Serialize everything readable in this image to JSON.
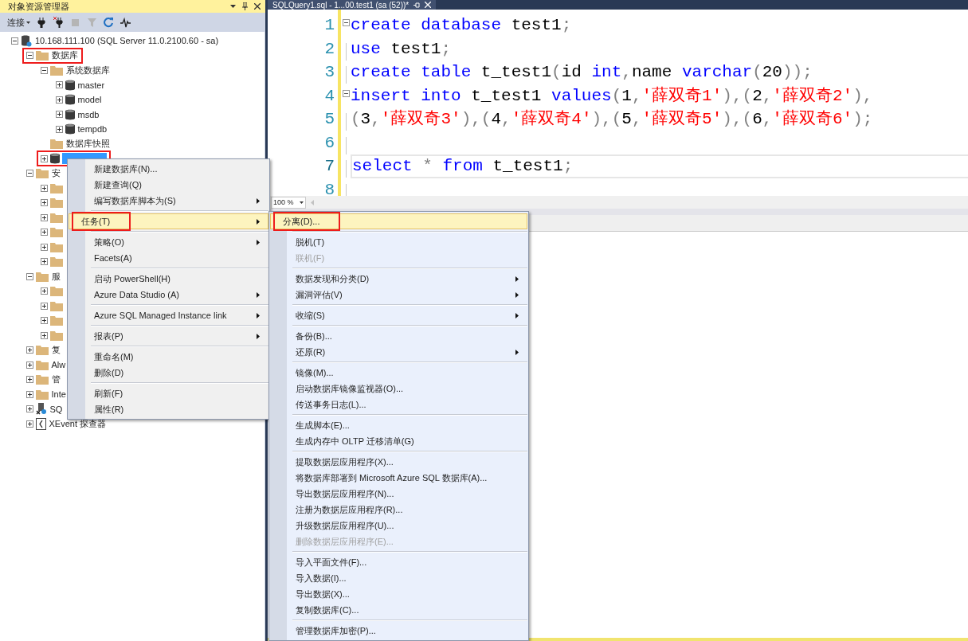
{
  "explorer": {
    "title": "对象资源管理器",
    "connect_label": "连接",
    "toolbar": [
      {
        "kind": "connect",
        "disabled": false
      },
      {
        "kind": "disconnect",
        "disabled": false
      },
      {
        "kind": "stop",
        "disabled": true
      },
      {
        "kind": "filter",
        "disabled": true
      },
      {
        "kind": "refresh",
        "disabled": false
      },
      {
        "kind": "activity",
        "disabled": false
      }
    ],
    "tree": [
      {
        "kind": "server",
        "label": "10.168.111.100 (SQL Server 11.0.2100.60 - sa)",
        "expanded": true,
        "selected": false,
        "annotated": false,
        "children": [
          {
            "kind": "folder",
            "label": "数据库",
            "expanded": true,
            "selected": false,
            "annotated": true,
            "children": [
              {
                "kind": "folder",
                "label": "系统数据库",
                "expanded": true,
                "selected": false,
                "annotated": false,
                "children": [
                  {
                    "kind": "database",
                    "label": "master",
                    "expanded": false,
                    "selected": false,
                    "annotated": false
                  },
                  {
                    "kind": "database",
                    "label": "model",
                    "expanded": false,
                    "selected": false,
                    "annotated": false
                  },
                  {
                    "kind": "database",
                    "label": "msdb",
                    "expanded": false,
                    "selected": false,
                    "annotated": false
                  },
                  {
                    "kind": "database",
                    "label": "tempdb",
                    "expanded": false,
                    "selected": false,
                    "annotated": false
                  }
                ]
              },
              {
                "kind": "folder",
                "label": "数据库快照",
                "selected": false,
                "annotated": false
              },
              {
                "kind": "database",
                "expanded": false,
                "selected": true,
                "annotated": true
              }
            ]
          },
          {
            "kind": "folder",
            "label": "安",
            "expanded": true,
            "selected": false,
            "annotated": false,
            "children": [
              {
                "kind": "folder",
                "expanded": false,
                "selected": false,
                "annotated": false
              },
              {
                "kind": "folder",
                "expanded": false,
                "selected": false,
                "annotated": false
              },
              {
                "kind": "folder",
                "expanded": false,
                "selected": false,
                "annotated": false
              },
              {
                "kind": "folder",
                "expanded": false,
                "selected": false,
                "annotated": false
              },
              {
                "kind": "folder",
                "expanded": false,
                "selected": false,
                "annotated": false
              },
              {
                "kind": "folder",
                "expanded": false,
                "selected": false,
                "annotated": false
              }
            ]
          },
          {
            "kind": "folder",
            "label": "服",
            "expanded": true,
            "selected": false,
            "annotated": false,
            "children": [
              {
                "kind": "folder",
                "expanded": false,
                "selected": false,
                "annotated": false
              },
              {
                "kind": "folder",
                "expanded": false,
                "selected": false,
                "annotated": false
              },
              {
                "kind": "folder",
                "expanded": false,
                "selected": false,
                "annotated": false
              },
              {
                "kind": "folder",
                "expanded": false,
                "selected": false,
                "annotated": false
              }
            ]
          },
          {
            "kind": "folder",
            "label": "复",
            "expanded": false,
            "selected": false,
            "annotated": false
          },
          {
            "kind": "folder",
            "label": "Alw",
            "expanded": false,
            "selected": false,
            "annotated": false
          },
          {
            "kind": "folder",
            "label": "管",
            "expanded": false,
            "selected": false,
            "annotated": false
          },
          {
            "kind": "folder",
            "label": "Inte",
            "expanded": false,
            "selected": false,
            "annotated": false
          },
          {
            "kind": "agent",
            "label": "SQ",
            "expanded": false,
            "selected": false,
            "annotated": false
          },
          {
            "kind": "xevent",
            "label": "XEvent 探查器",
            "expanded": false,
            "selected": false,
            "annotated": false
          }
        ]
      }
    ]
  },
  "editor": {
    "tab_title": "SQLQuery1.sql - 1...00.test1 (sa (52))*",
    "zoom": "100 %",
    "lines": [
      {
        "number": "1",
        "foldable": true,
        "current": false,
        "tokens": [
          {
            "kind": "keyword",
            "text": "create "
          },
          {
            "kind": "keyword",
            "text": "database"
          },
          {
            "kind": "text",
            "text": " test1"
          },
          {
            "kind": "punct",
            "text": ";"
          }
        ]
      },
      {
        "number": "2",
        "foldable": false,
        "current": false,
        "tokens": [
          {
            "kind": "keyword",
            "text": "use"
          },
          {
            "kind": "text",
            "text": " test1"
          },
          {
            "kind": "punct",
            "text": ";"
          }
        ]
      },
      {
        "number": "3",
        "foldable": false,
        "current": false,
        "tokens": [
          {
            "kind": "keyword",
            "text": "create "
          },
          {
            "kind": "keyword",
            "text": "table"
          },
          {
            "kind": "text",
            "text": " t_test1"
          },
          {
            "kind": "punct",
            "text": "("
          },
          {
            "kind": "text",
            "text": "id "
          },
          {
            "kind": "keyword",
            "text": "int"
          },
          {
            "kind": "punct",
            "text": ","
          },
          {
            "kind": "text",
            "text": "name "
          },
          {
            "kind": "keyword",
            "text": "varchar"
          },
          {
            "kind": "punct",
            "text": "("
          },
          {
            "kind": "text",
            "text": "20"
          },
          {
            "kind": "punct",
            "text": "));"
          }
        ]
      },
      {
        "number": "4",
        "foldable": true,
        "current": false,
        "tokens": [
          {
            "kind": "keyword",
            "text": "insert "
          },
          {
            "kind": "keyword",
            "text": "into"
          },
          {
            "kind": "text",
            "text": " t_test1 "
          },
          {
            "kind": "keyword",
            "text": "values"
          },
          {
            "kind": "punct",
            "text": "("
          },
          {
            "kind": "text",
            "text": "1"
          },
          {
            "kind": "punct",
            "text": ","
          },
          {
            "kind": "string",
            "text": "'薛双奇1'"
          },
          {
            "kind": "punct",
            "text": "),("
          },
          {
            "kind": "text",
            "text": "2"
          },
          {
            "kind": "punct",
            "text": ","
          },
          {
            "kind": "string",
            "text": "'薛双奇2'"
          },
          {
            "kind": "punct",
            "text": "),"
          }
        ]
      },
      {
        "number": "5",
        "foldable": false,
        "current": false,
        "tokens": [
          {
            "kind": "punct",
            "text": "("
          },
          {
            "kind": "text",
            "text": "3"
          },
          {
            "kind": "punct",
            "text": ","
          },
          {
            "kind": "string",
            "text": "'薛双奇3'"
          },
          {
            "kind": "punct",
            "text": "),("
          },
          {
            "kind": "text",
            "text": "4"
          },
          {
            "kind": "punct",
            "text": ","
          },
          {
            "kind": "string",
            "text": "'薛双奇4'"
          },
          {
            "kind": "punct",
            "text": "),("
          },
          {
            "kind": "text",
            "text": "5"
          },
          {
            "kind": "punct",
            "text": ","
          },
          {
            "kind": "string",
            "text": "'薛双奇5'"
          },
          {
            "kind": "punct",
            "text": "),("
          },
          {
            "kind": "text",
            "text": "6"
          },
          {
            "kind": "punct",
            "text": ","
          },
          {
            "kind": "string",
            "text": "'薛双奇6'"
          },
          {
            "kind": "punct",
            "text": ");"
          }
        ]
      },
      {
        "number": "6",
        "foldable": false,
        "current": false
      },
      {
        "number": "7",
        "foldable": false,
        "current": true,
        "tokens": [
          {
            "kind": "keyword",
            "text": "select "
          },
          {
            "kind": "punct",
            "text": "* "
          },
          {
            "kind": "keyword",
            "text": "from"
          },
          {
            "kind": "text",
            "text": " t_test1"
          },
          {
            "kind": "punct",
            "text": ";"
          }
        ]
      },
      {
        "number": "8",
        "foldable": false,
        "current": false
      }
    ]
  },
  "context_menu": {
    "items": [
      {
        "kind": "item",
        "label": "新建数据库(N)...",
        "submenu": false,
        "disabled": false,
        "selected": false,
        "annotated": false
      },
      {
        "kind": "item",
        "label": "新建查询(Q)",
        "submenu": false,
        "disabled": false,
        "selected": false,
        "annotated": false
      },
      {
        "kind": "item",
        "label": "编写数据库脚本为(S)",
        "submenu": true,
        "disabled": false,
        "selected": false,
        "annotated": false
      },
      {
        "kind": "separator"
      },
      {
        "kind": "item",
        "label": "任务(T)",
        "submenu": true,
        "disabled": false,
        "selected": true,
        "annotated": true
      },
      {
        "kind": "separator"
      },
      {
        "kind": "item",
        "label": "策略(O)",
        "submenu": true,
        "disabled": false,
        "selected": false,
        "annotated": false
      },
      {
        "kind": "item",
        "label": "Facets(A)",
        "submenu": false,
        "disabled": false,
        "selected": false,
        "annotated": false
      },
      {
        "kind": "separator"
      },
      {
        "kind": "item",
        "label": "启动 PowerShell(H)",
        "submenu": false,
        "disabled": false,
        "selected": false,
        "annotated": false
      },
      {
        "kind": "item",
        "label": "Azure Data Studio (A)",
        "submenu": true,
        "disabled": false,
        "selected": false,
        "annotated": false
      },
      {
        "kind": "separator"
      },
      {
        "kind": "item",
        "label": "Azure SQL Managed Instance link",
        "submenu": true,
        "disabled": false,
        "selected": false,
        "annotated": false
      },
      {
        "kind": "separator"
      },
      {
        "kind": "item",
        "label": "报表(P)",
        "submenu": true,
        "disabled": false,
        "selected": false,
        "annotated": false
      },
      {
        "kind": "separator"
      },
      {
        "kind": "item",
        "label": "重命名(M)",
        "submenu": false,
        "disabled": false,
        "selected": false,
        "annotated": false
      },
      {
        "kind": "item",
        "label": "删除(D)",
        "submenu": false,
        "disabled": false,
        "selected": false,
        "annotated": false
      },
      {
        "kind": "separator"
      },
      {
        "kind": "item",
        "label": "刷新(F)",
        "submenu": false,
        "disabled": false,
        "selected": false,
        "annotated": false
      },
      {
        "kind": "item",
        "label": "属性(R)",
        "submenu": false,
        "disabled": false,
        "selected": false,
        "annotated": false
      }
    ]
  },
  "tasks_submenu": {
    "items": [
      {
        "kind": "item",
        "label": "分离(D)...",
        "submenu": false,
        "disabled": false,
        "selected": true,
        "annotated": true
      },
      {
        "kind": "separator"
      },
      {
        "kind": "item",
        "label": "脱机(T)",
        "submenu": false,
        "disabled": false,
        "selected": false,
        "annotated": false
      },
      {
        "kind": "item",
        "label": "联机(F)",
        "submenu": false,
        "disabled": true,
        "selected": false,
        "annotated": false
      },
      {
        "kind": "separator"
      },
      {
        "kind": "item",
        "label": "数据发现和分类(D)",
        "submenu": true,
        "disabled": false,
        "selected": false,
        "annotated": false
      },
      {
        "kind": "item",
        "label": "漏洞评估(V)",
        "submenu": true,
        "disabled": false,
        "selected": false,
        "annotated": false
      },
      {
        "kind": "separator"
      },
      {
        "kind": "item",
        "label": "收缩(S)",
        "submenu": true,
        "disabled": false,
        "selected": false,
        "annotated": false
      },
      {
        "kind": "separator"
      },
      {
        "kind": "item",
        "label": "备份(B)...",
        "submenu": false,
        "disabled": false,
        "selected": false,
        "annotated": false
      },
      {
        "kind": "item",
        "label": "还原(R)",
        "submenu": true,
        "disabled": false,
        "selected": false,
        "annotated": false
      },
      {
        "kind": "separator"
      },
      {
        "kind": "item",
        "label": "镜像(M)...",
        "submenu": false,
        "disabled": false,
        "selected": false,
        "annotated": false
      },
      {
        "kind": "item",
        "label": "启动数据库镜像监视器(O)...",
        "submenu": false,
        "disabled": false,
        "selected": false,
        "annotated": false
      },
      {
        "kind": "item",
        "label": "传送事务日志(L)...",
        "submenu": false,
        "disabled": false,
        "selected": false,
        "annotated": false
      },
      {
        "kind": "separator"
      },
      {
        "kind": "item",
        "label": "生成脚本(E)...",
        "submenu": false,
        "disabled": false,
        "selected": false,
        "annotated": false
      },
      {
        "kind": "item",
        "label": "生成内存中 OLTP 迁移清单(G)",
        "submenu": false,
        "disabled": false,
        "selected": false,
        "annotated": false
      },
      {
        "kind": "separator"
      },
      {
        "kind": "item",
        "label": "提取数据层应用程序(X)...",
        "submenu": false,
        "disabled": false,
        "selected": false,
        "annotated": false
      },
      {
        "kind": "item",
        "label": "将数据库部署到 Microsoft Azure SQL 数据库(A)...",
        "submenu": false,
        "disabled": false,
        "selected": false,
        "annotated": false
      },
      {
        "kind": "item",
        "label": "导出数据层应用程序(N)...",
        "submenu": false,
        "disabled": false,
        "selected": false,
        "annotated": false
      },
      {
        "kind": "item",
        "label": "注册为数据层应用程序(R)...",
        "submenu": false,
        "disabled": false,
        "selected": false,
        "annotated": false
      },
      {
        "kind": "item",
        "label": "升级数据层应用程序(U)...",
        "submenu": false,
        "disabled": false,
        "selected": false,
        "annotated": false
      },
      {
        "kind": "item",
        "label": "删除数据层应用程序(E)...",
        "submenu": false,
        "disabled": true,
        "selected": false,
        "annotated": false
      },
      {
        "kind": "separator"
      },
      {
        "kind": "item",
        "label": "导入平面文件(F)...",
        "submenu": false,
        "disabled": false,
        "selected": false,
        "annotated": false
      },
      {
        "kind": "item",
        "label": "导入数据(I)...",
        "submenu": false,
        "disabled": false,
        "selected": false,
        "annotated": false
      },
      {
        "kind": "item",
        "label": "导出数据(X)...",
        "submenu": false,
        "disabled": false,
        "selected": false,
        "annotated": false
      },
      {
        "kind": "item",
        "label": "复制数据库(C)...",
        "submenu": false,
        "disabled": false,
        "selected": false,
        "annotated": false
      },
      {
        "kind": "separator"
      },
      {
        "kind": "item",
        "label": "管理数据库加密(P)...",
        "submenu": false,
        "disabled": false,
        "selected": false,
        "annotated": false
      }
    ]
  }
}
